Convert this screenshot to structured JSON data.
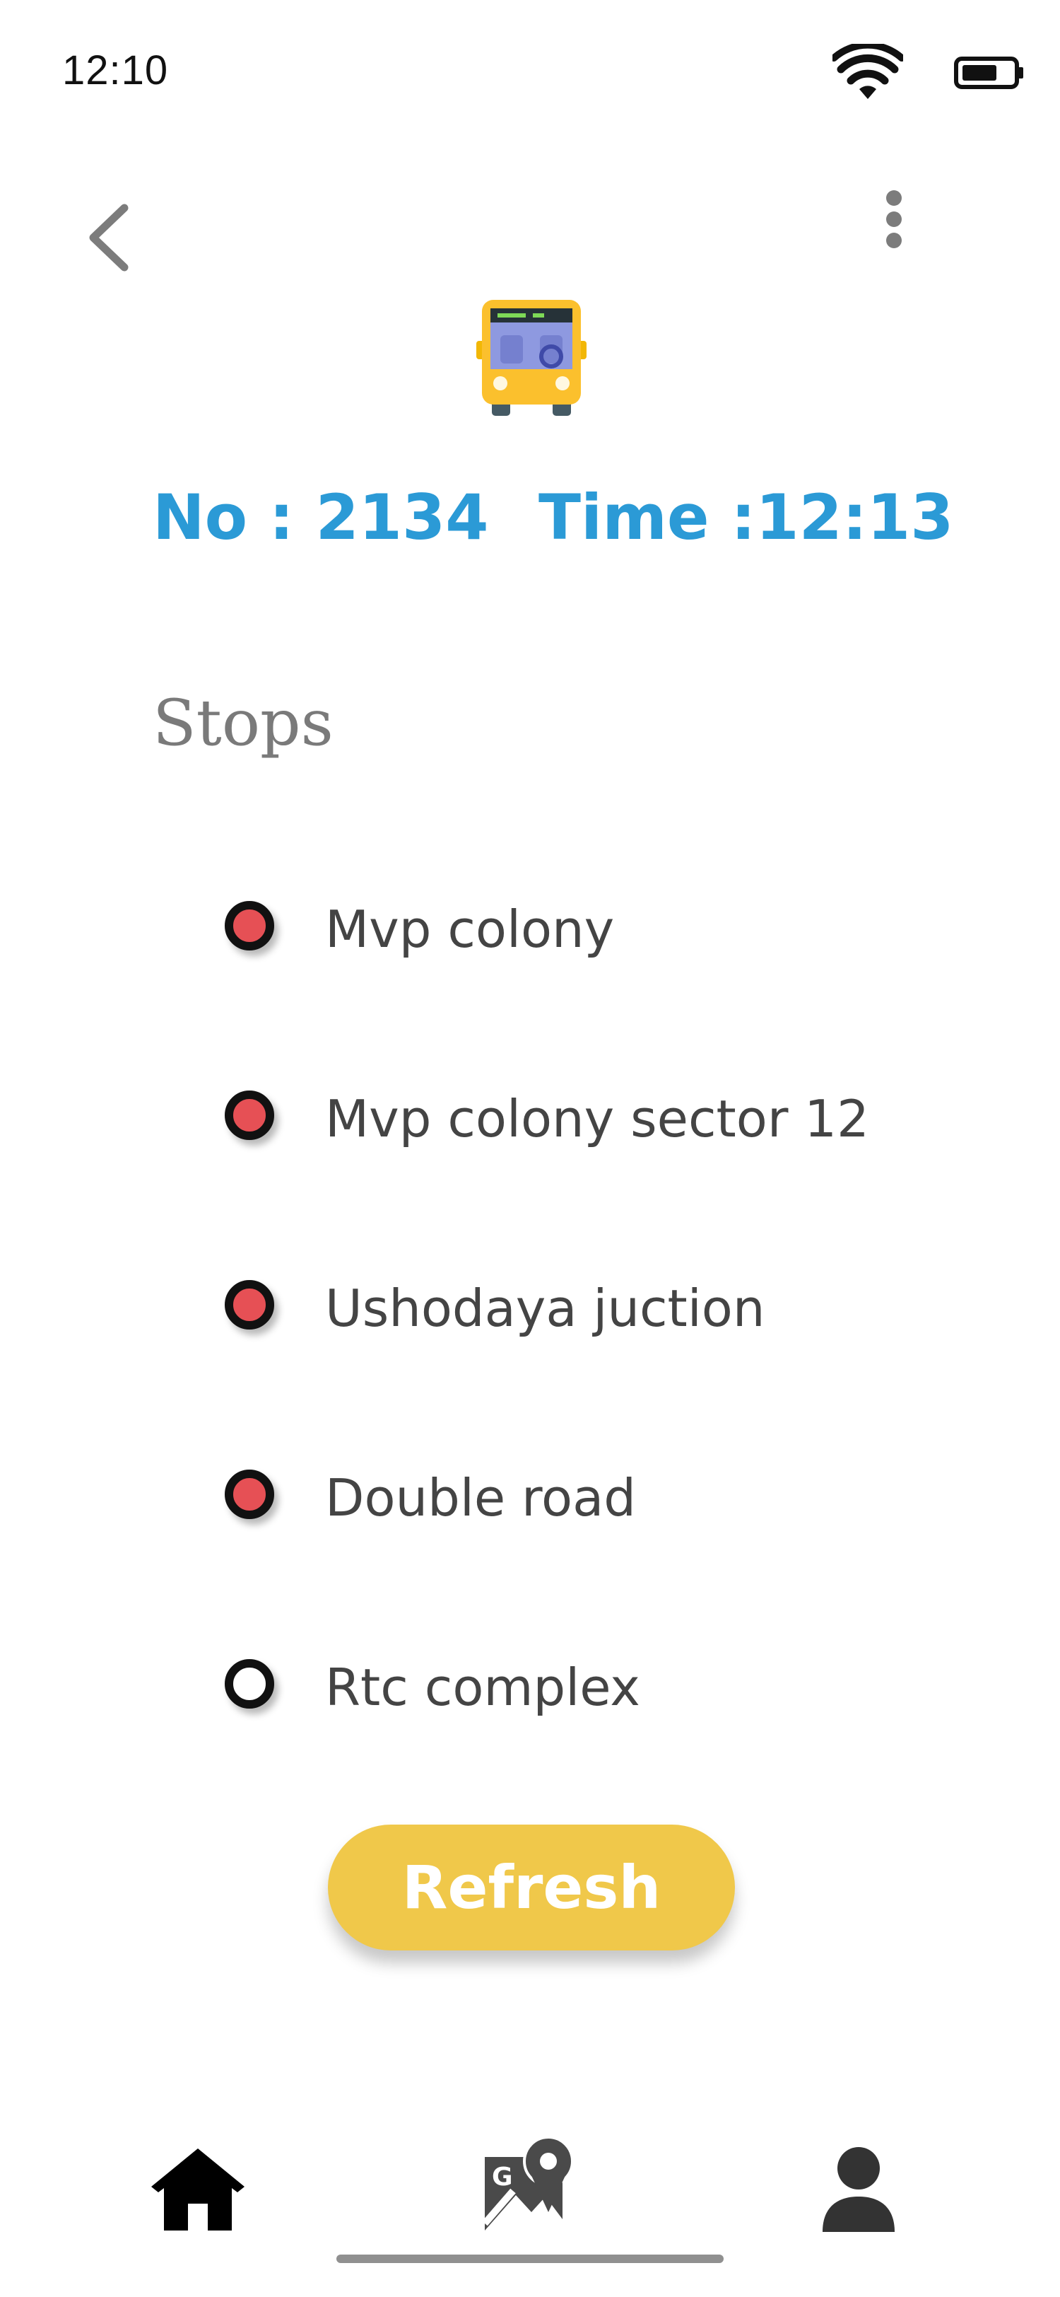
{
  "status_bar": {
    "time": "12:10"
  },
  "header": {
    "back_icon": "chevron-left-icon",
    "menu_icon": "more-vert-icon"
  },
  "bus": {
    "icon": "bus-icon",
    "number_text": "No : 2134",
    "time_text": "Time :12:13"
  },
  "stops": {
    "heading": "Stops",
    "items": [
      {
        "label": "Mvp colony",
        "state": "visited"
      },
      {
        "label": "Mvp colony sector 12",
        "state": "visited"
      },
      {
        "label": "Ushodaya juction",
        "state": "visited"
      },
      {
        "label": "Double road",
        "state": "visited"
      },
      {
        "label": "Rtc complex",
        "state": "pending"
      }
    ]
  },
  "actions": {
    "refresh_label": "Refresh"
  },
  "colors": {
    "accent_blue": "#2b9ad6",
    "button_yellow": "#f0c84a",
    "visited_red": "#e65055"
  },
  "bottom_nav": {
    "items": [
      {
        "icon": "home-icon"
      },
      {
        "icon": "map-icon"
      },
      {
        "icon": "profile-icon"
      }
    ]
  }
}
